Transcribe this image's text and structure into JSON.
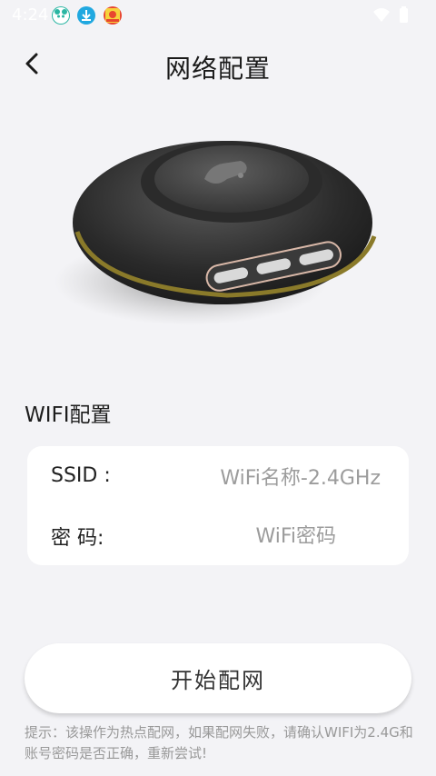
{
  "status_bar": {
    "time": "4:24",
    "notifications": [
      "panda-app-icon",
      "download-icon",
      "store-app-icon"
    ],
    "system_icons": [
      "wifi-icon",
      "battery-icon"
    ]
  },
  "header": {
    "back_icon": "chevron-left-icon",
    "title": "网络配置"
  },
  "device_image": {
    "icon": "smart-hub-device-image"
  },
  "wifi_section": {
    "label": "WIFI配置",
    "ssid": {
      "label": "SSID :",
      "placeholder": "WiFi名称-2.4GHz",
      "value": ""
    },
    "password": {
      "label": "密 码:",
      "placeholder": "WiFi密码",
      "value": ""
    }
  },
  "start_button": {
    "label": "开始配网"
  },
  "tip_text": "提示：该操作为热点配网，如果配网失败，请确认WIFI为2.4G和账号密码是否正确，重新尝试!",
  "colors": {
    "background": "#f3f3f6",
    "card": "#ffffff",
    "placeholder": "#9c9c9c",
    "tip": "#999999"
  }
}
